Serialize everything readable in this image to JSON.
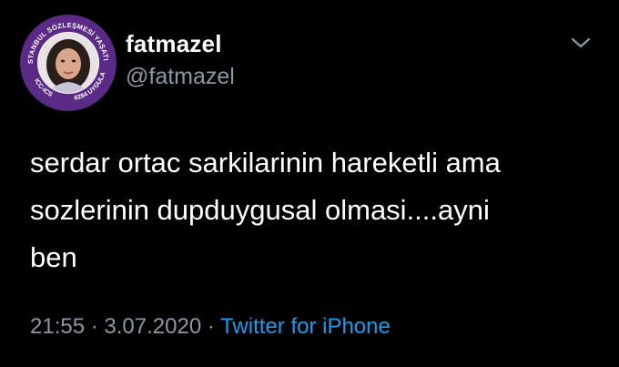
{
  "user": {
    "display_name": "fatmazel",
    "handle": "@fatmazel",
    "avatar_ring_text_top": "İSTANBUL SÖZLEŞMESİ YAŞATIR",
    "avatar_ring_text_bottom_left": "ICC-ICS",
    "avatar_ring_text_bottom_right": "6284 UYGULA"
  },
  "tweet": {
    "text": "serdar ortac sarkilarinin hareketli ama\nsozlerinin dupduygusal olmasi....ayni\nben",
    "time": "21:55",
    "separator": "·",
    "date": "3.07.2020",
    "source": "Twitter for iPhone"
  },
  "icons": {
    "caret": "chevron-down-icon"
  },
  "colors": {
    "background": "#000000",
    "text": "#ffffff",
    "secondary_text": "#8b98a5",
    "link": "#1d9bf0",
    "avatar_ring": "#5b2a86"
  }
}
